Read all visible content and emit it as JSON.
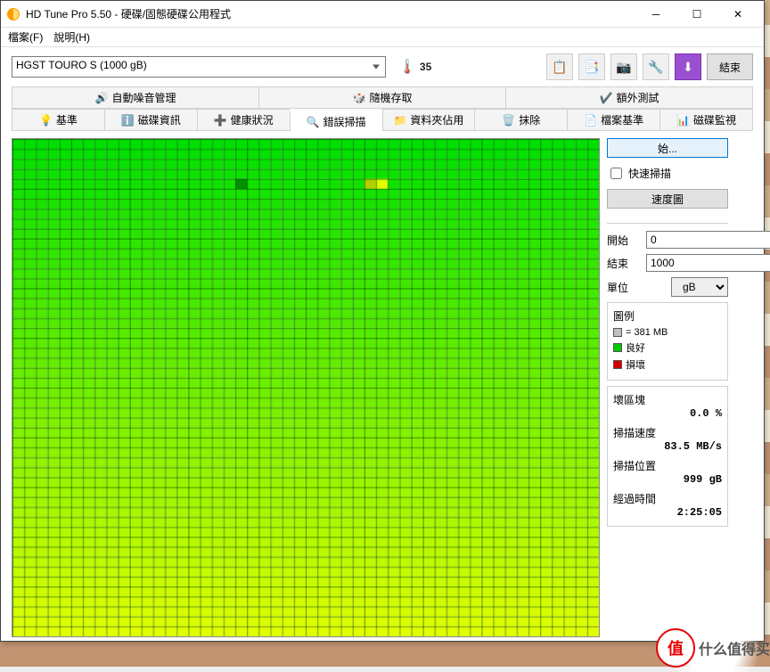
{
  "window": {
    "title": "HD Tune Pro 5.50 - 硬碟/固態硬碟公用程式"
  },
  "menu": {
    "file": "檔案(F)",
    "help": "說明(H)"
  },
  "toolbar": {
    "drive_selected": "HGST   TOURO S (1000 gB)",
    "temperature": "35",
    "exit_label": "結束"
  },
  "tabs_top": [
    "自動噪音管理",
    "隨機存取",
    "額外測試"
  ],
  "tabs_bottom": [
    "基準",
    "磁碟資訊",
    "健康狀況",
    "錯誤掃描",
    "資料夾佔用",
    "抹除",
    "檔案基準",
    "磁碟監視"
  ],
  "active_tab": "錯誤掃描",
  "side": {
    "start_btn": "始...",
    "quick_scan": "快速掃描",
    "speedmap_btn": "速度圖",
    "start_label": "開始",
    "start_val": "0",
    "end_label": "結束",
    "end_val": "1000",
    "unit_label": "單位",
    "unit_val": "gB"
  },
  "legend": {
    "title": "圖例",
    "block_size": "= 381 MB",
    "ok": "良好",
    "bad": "損壞",
    "ok_color": "#00c800",
    "bad_color": "#d40000",
    "empty_color": "#c0c0c0"
  },
  "stats": {
    "bad_blocks_lbl": "壞區塊",
    "bad_blocks_val": "0.0 %",
    "speed_lbl": "掃描速度",
    "speed_val": "83.5 MB/s",
    "pos_lbl": "掃描位置",
    "pos_val": "999 gB",
    "elapsed_lbl": "經過時間",
    "elapsed_val": "2:25:05"
  },
  "scan_map": {
    "cols": 50,
    "rows": 50,
    "gradient_top": "#00e000",
    "gradient_bottom": "#e0ff00",
    "anomalies": [
      {
        "row": 4,
        "col": 19,
        "color": "#009000"
      },
      {
        "row": 4,
        "col": 30,
        "color": "#b0d000"
      },
      {
        "row": 4,
        "col": 31,
        "color": "#e0ff00"
      }
    ]
  },
  "watermark": {
    "logo": "值",
    "text": "什么值得买"
  }
}
